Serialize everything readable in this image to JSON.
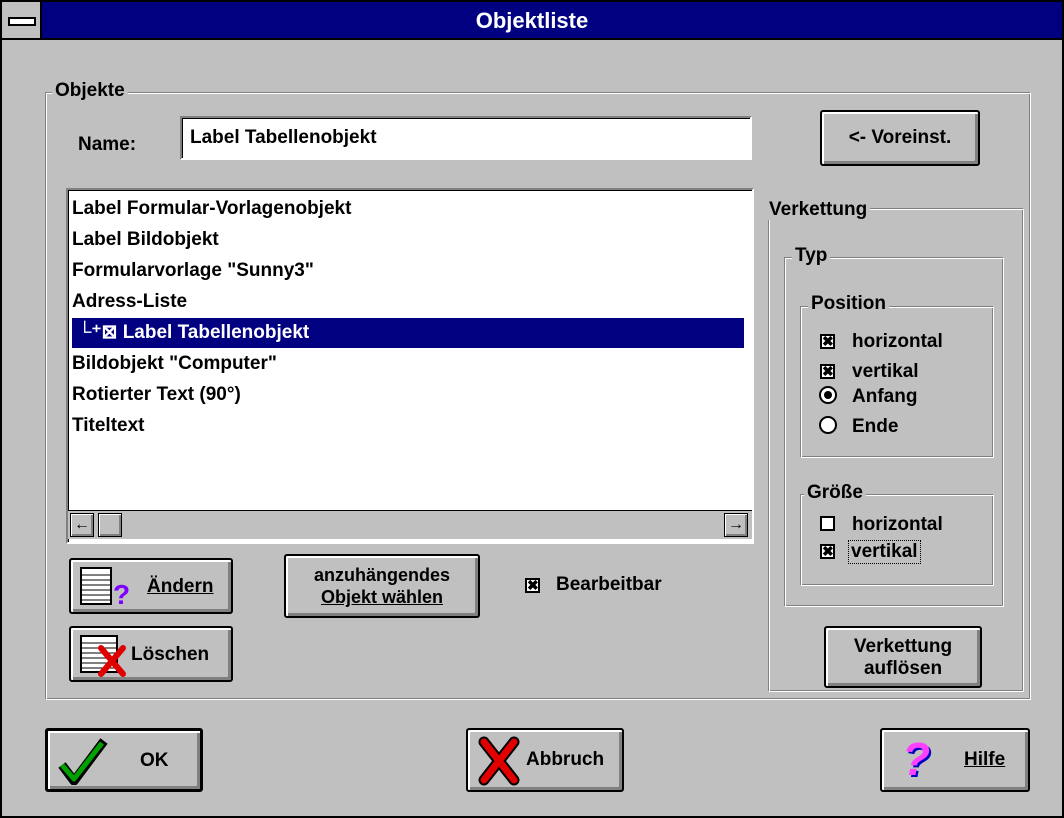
{
  "window": {
    "title": "Objektliste"
  },
  "objekte": {
    "group_label": "Objekte",
    "name_label": "Name:",
    "name_value": "Label Tabellenobjekt",
    "default_button": "<- Voreinst.",
    "list_items": [
      "Label Formular-Vorlagenobjekt",
      "Label Bildobjekt",
      "Formularvorlage \"Sunny3\"",
      "Adress-Liste",
      "Label Tabellenobjekt",
      "Bildobjekt \"Computer\"",
      "Rotierter Text (90°)",
      "Titeltext"
    ],
    "selected_index": 4,
    "selected_prefix": "└⁺⊠",
    "scroll_left": "←",
    "scroll_right": "→",
    "aendern_label": "Ändern",
    "loeschen_label": "Löschen",
    "attach_line1": "anzuhängendes",
    "attach_line2": "Objekt wählen",
    "editable_label": "Bearbeitbar",
    "editable_checked": true
  },
  "verkettung": {
    "group_label": "Verkettung",
    "typ_label": "Typ",
    "position_label": "Position",
    "pos_horizontal": "horizontal",
    "pos_vertikal": "vertikal",
    "anfang": "Anfang",
    "ende": "Ende",
    "groesse_label": "Größe",
    "size_horizontal": "horizontal",
    "size_vertikal": "vertikal",
    "checks": {
      "pos_horizontal": true,
      "pos_vertikal": true,
      "size_horizontal": false,
      "size_vertikal": true
    },
    "radio_selected": "anfang",
    "dissolve_line1": "Verkettung",
    "dissolve_line2": "auflösen"
  },
  "footer": {
    "ok": "OK",
    "abbruch": "Abbruch",
    "hilfe": "Hilfe"
  },
  "colors": {
    "face": "#c0c0c0",
    "titlebar": "#000080",
    "selection": "#000080"
  }
}
